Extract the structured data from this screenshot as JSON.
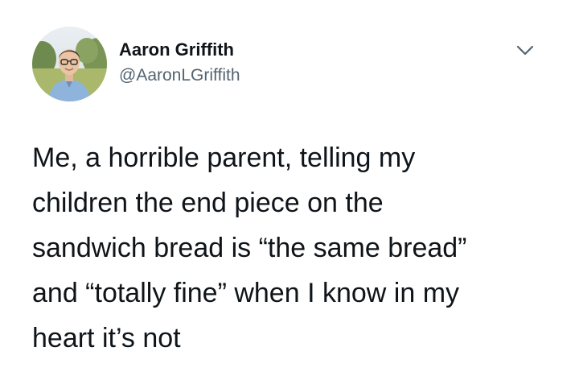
{
  "author": {
    "display_name": "Aaron Griffith",
    "handle": "@AaronLGriffith"
  },
  "icons": {
    "avatar": "profile-photo",
    "menu": "chevron-down-icon"
  },
  "colors": {
    "text": "#0f1419",
    "handle": "#536471",
    "chevron": "#536471"
  },
  "tweet": {
    "lines": [
      "Me, a horrible parent, telling my",
      "children the end piece on the",
      "sandwich bread is “the same bread”",
      "and “totally fine” when I know in my",
      "heart it’s not"
    ]
  }
}
